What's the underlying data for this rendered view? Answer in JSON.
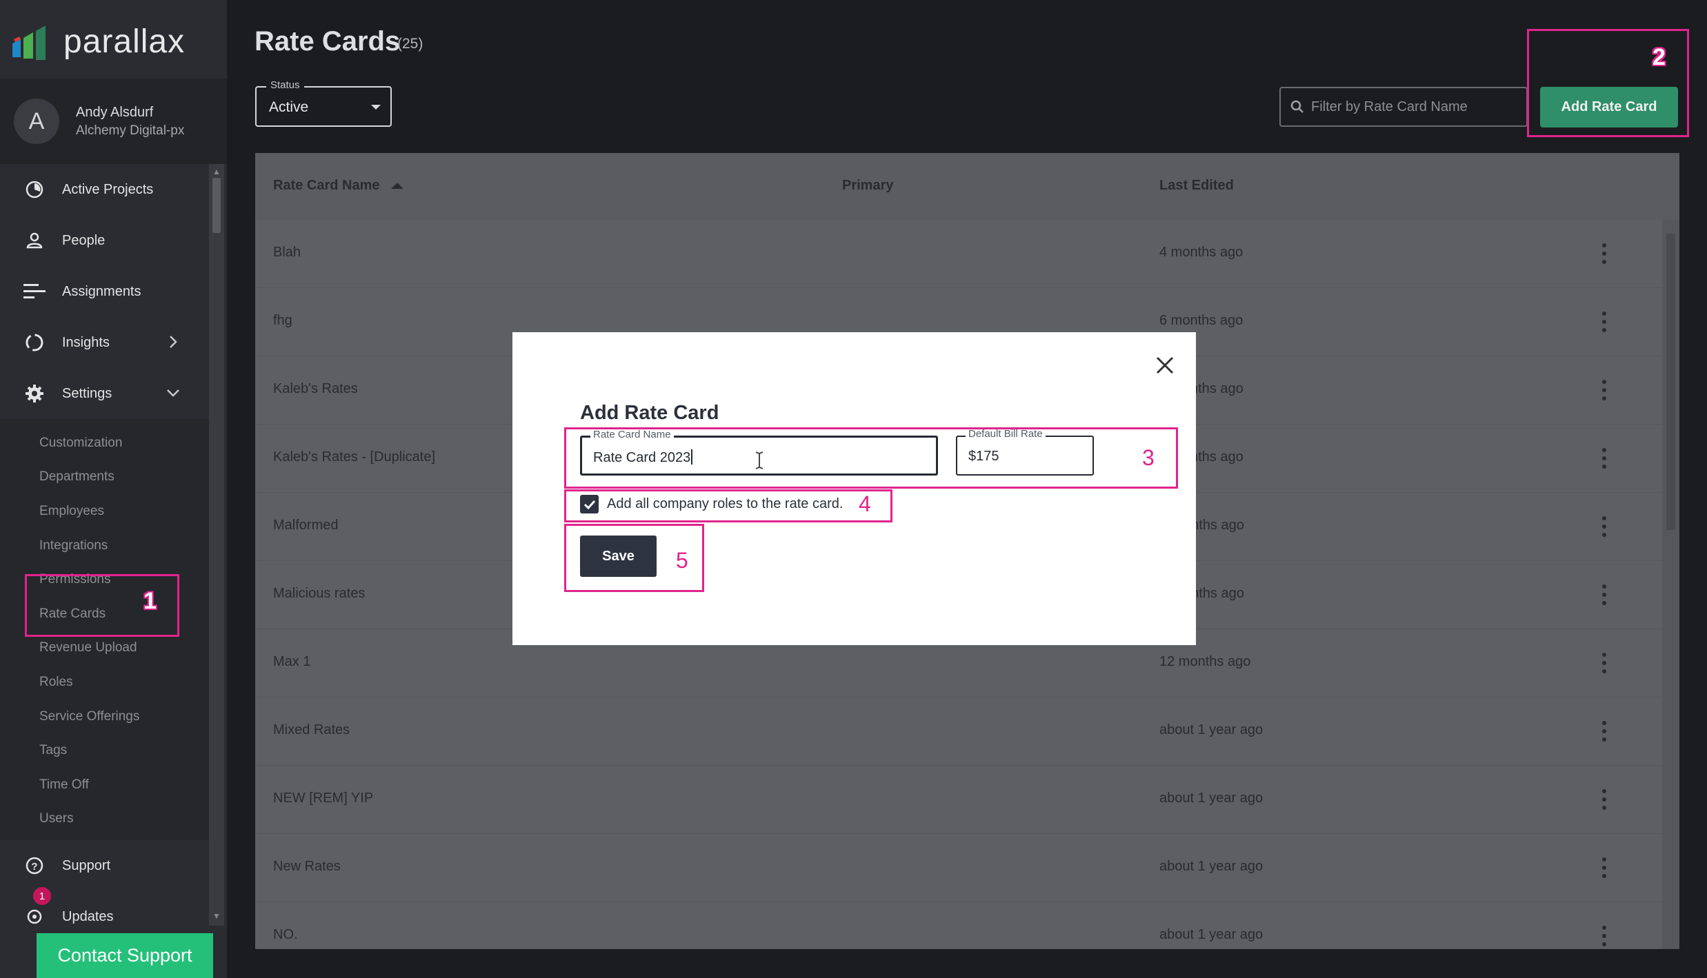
{
  "app": {
    "brand": "parallax"
  },
  "user": {
    "initial": "A",
    "name": "Andy Alsdurf",
    "company": "Alchemy Digital-px"
  },
  "nav": {
    "active_projects": "Active Projects",
    "people": "People",
    "assignments": "Assignments",
    "insights": "Insights",
    "settings": "Settings",
    "support": "Support",
    "updates": "Updates",
    "updates_badge": "1"
  },
  "settings_sub": [
    "Customization",
    "Departments",
    "Employees",
    "Integrations",
    "Permissions",
    "Rate Cards",
    "Revenue Upload",
    "Roles",
    "Service Offerings",
    "Tags",
    "Time Off",
    "Users"
  ],
  "contact_support": "Contact Support",
  "page": {
    "title": "Rate Cards",
    "count": "(25)",
    "status_label": "Status",
    "status_value": "Active",
    "filter_placeholder": "Filter by Rate Card Name",
    "add_button": "Add Rate Card"
  },
  "table": {
    "headers": {
      "name": "Rate Card Name",
      "primary": "Primary",
      "last_edited": "Last Edited"
    },
    "rows": [
      {
        "name": "Blah",
        "edited": "4 months ago"
      },
      {
        "name": "fhg",
        "edited": "6 months ago"
      },
      {
        "name": "Kaleb's Rates",
        "edited": "nths ago"
      },
      {
        "name": "Kaleb's Rates - [Duplicate]",
        "edited": "nths ago"
      },
      {
        "name": "Malformed",
        "edited": "onths ago"
      },
      {
        "name": "Malicious rates",
        "edited": "onths ago"
      },
      {
        "name": "Max 1",
        "edited": "12 months ago"
      },
      {
        "name": "Mixed Rates",
        "edited": "about 1 year ago"
      },
      {
        "name": "NEW [REM] YIP",
        "edited": "about 1 year ago"
      },
      {
        "name": "New Rates",
        "edited": "about 1 year ago"
      },
      {
        "name": "NO.",
        "edited": "about 1 year ago"
      }
    ]
  },
  "modal": {
    "title": "Add Rate Card",
    "name_label": "Rate Card Name",
    "name_value": "Rate Card 2023",
    "rate_label": "Default Bill Rate",
    "rate_value": "$175",
    "checkbox_label": "Add all company roles to the rate card.",
    "checkbox_checked": true,
    "save": "Save"
  },
  "annotations": [
    "1",
    "2",
    "3",
    "4",
    "5"
  ],
  "colors": {
    "accent_green": "#2e8f68",
    "contact_green": "#24c07a",
    "annotation_pink": "#e0248c",
    "dark_button": "#2e3340"
  }
}
